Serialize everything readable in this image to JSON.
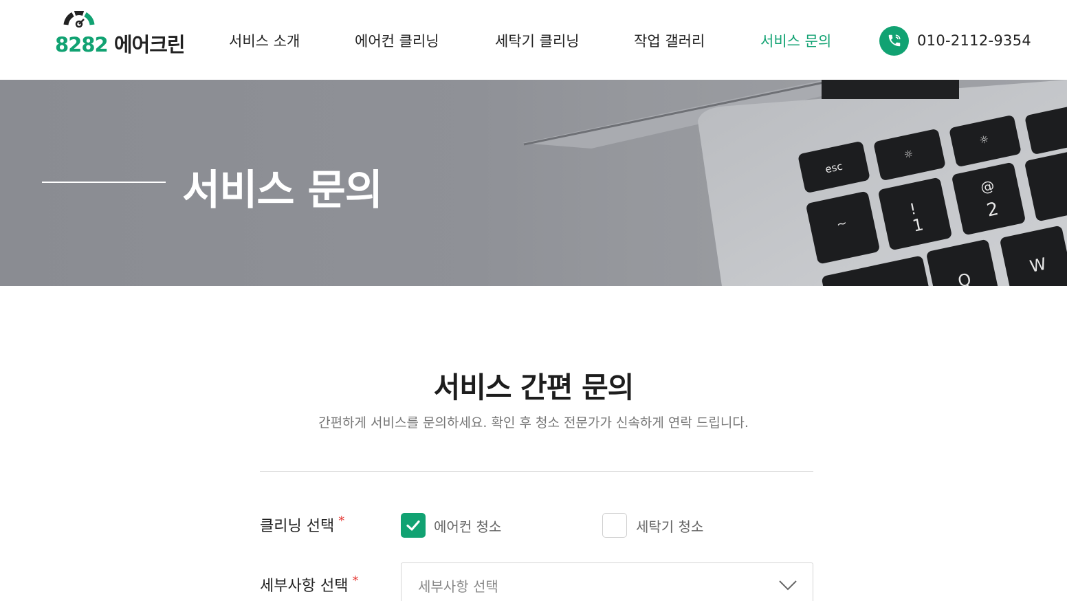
{
  "brand": {
    "number": "8282",
    "name": "에어크린",
    "accent_color": "#11a272"
  },
  "nav": {
    "items": [
      {
        "label": "서비스 소개",
        "active": false
      },
      {
        "label": "에어컨 클리닝",
        "active": false
      },
      {
        "label": "세탁기 클리닝",
        "active": false
      },
      {
        "label": "작업 갤러리",
        "active": false
      },
      {
        "label": "서비스 문의",
        "active": true
      }
    ]
  },
  "contact": {
    "phone": "010-2112-9354",
    "icon": "phone-icon"
  },
  "banner": {
    "title": "서비스 문의"
  },
  "section": {
    "title": "서비스 간편 문의",
    "subtitle": "간편하게 서비스를 문의하세요. 확인 후 청소 전문가가 신속하게 연락 드립니다."
  },
  "form": {
    "cleaning": {
      "label": "클리닝 선택",
      "required_mark": "*",
      "options": [
        {
          "label": "에어컨 청소",
          "checked": true
        },
        {
          "label": "세탁기 청소",
          "checked": false
        }
      ]
    },
    "detail": {
      "label": "세부사항 선택",
      "required_mark": "*",
      "placeholder": "세부사항 선택"
    }
  }
}
